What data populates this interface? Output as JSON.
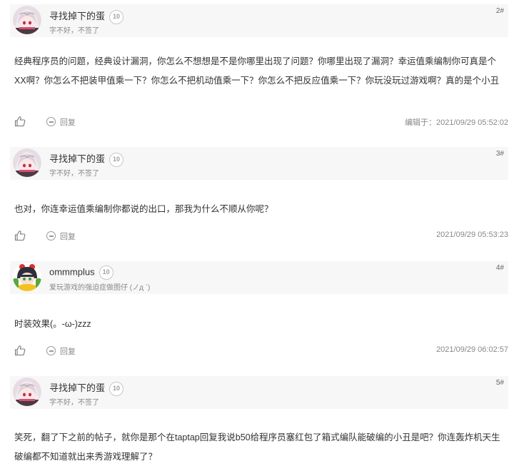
{
  "posts": [
    {
      "username": "寻找掉下的蛋",
      "level": "10",
      "signature": "字不好，不签了",
      "floor": "2#",
      "content": "经典程序员的问题，经典设计漏洞，你怎么不想想是不是你哪里出现了问题？你哪里出现了漏洞？幸运值乘编制你可真是个XX啊？你怎么不把装甲值乘一下？你怎么不把机动值乘一下？你怎么不把反应值乘一下？你玩没玩过游戏啊？真的是个小丑",
      "reply_label": "回复",
      "time": "编辑于：2021/09/29 05:52:02"
    },
    {
      "username": "寻找掉下的蛋",
      "level": "10",
      "signature": "字不好，不签了",
      "floor": "3#",
      "content": "也对，你连幸运值乘编制你都说的出口，那我为什么不顺从你呢？",
      "reply_label": "回复",
      "time": "2021/09/29 05:53:23"
    },
    {
      "username": "ommmplus",
      "level": "10",
      "signature": "爱玩游戏的强迫症做图仔 (ノд ˋ)",
      "floor": "4#",
      "content": "时装效果(。-ω-)zzz",
      "reply_label": "回复",
      "time": "2021/09/29 06:02:57"
    },
    {
      "username": "寻找掉下的蛋",
      "level": "10",
      "signature": "字不好，不签了",
      "floor": "5#",
      "content": "笑死，翻了下之前的帖子，就你是那个在taptap回复我说b50给程序员塞红包了箱式编队能破编的小丑是吧？你连轰炸机天生破编都不知道就出来秀游戏理解了？",
      "reply_label": "",
      "time": ""
    }
  ],
  "colors": {
    "header_bg": "#f7f7f7",
    "text": "#333333",
    "muted": "#888888"
  },
  "icons": [
    "avatar-girl-pink",
    "avatar-chibi-green",
    "thumbs-up-icon",
    "reply-bubble-icon",
    "level-badge-icon"
  ]
}
